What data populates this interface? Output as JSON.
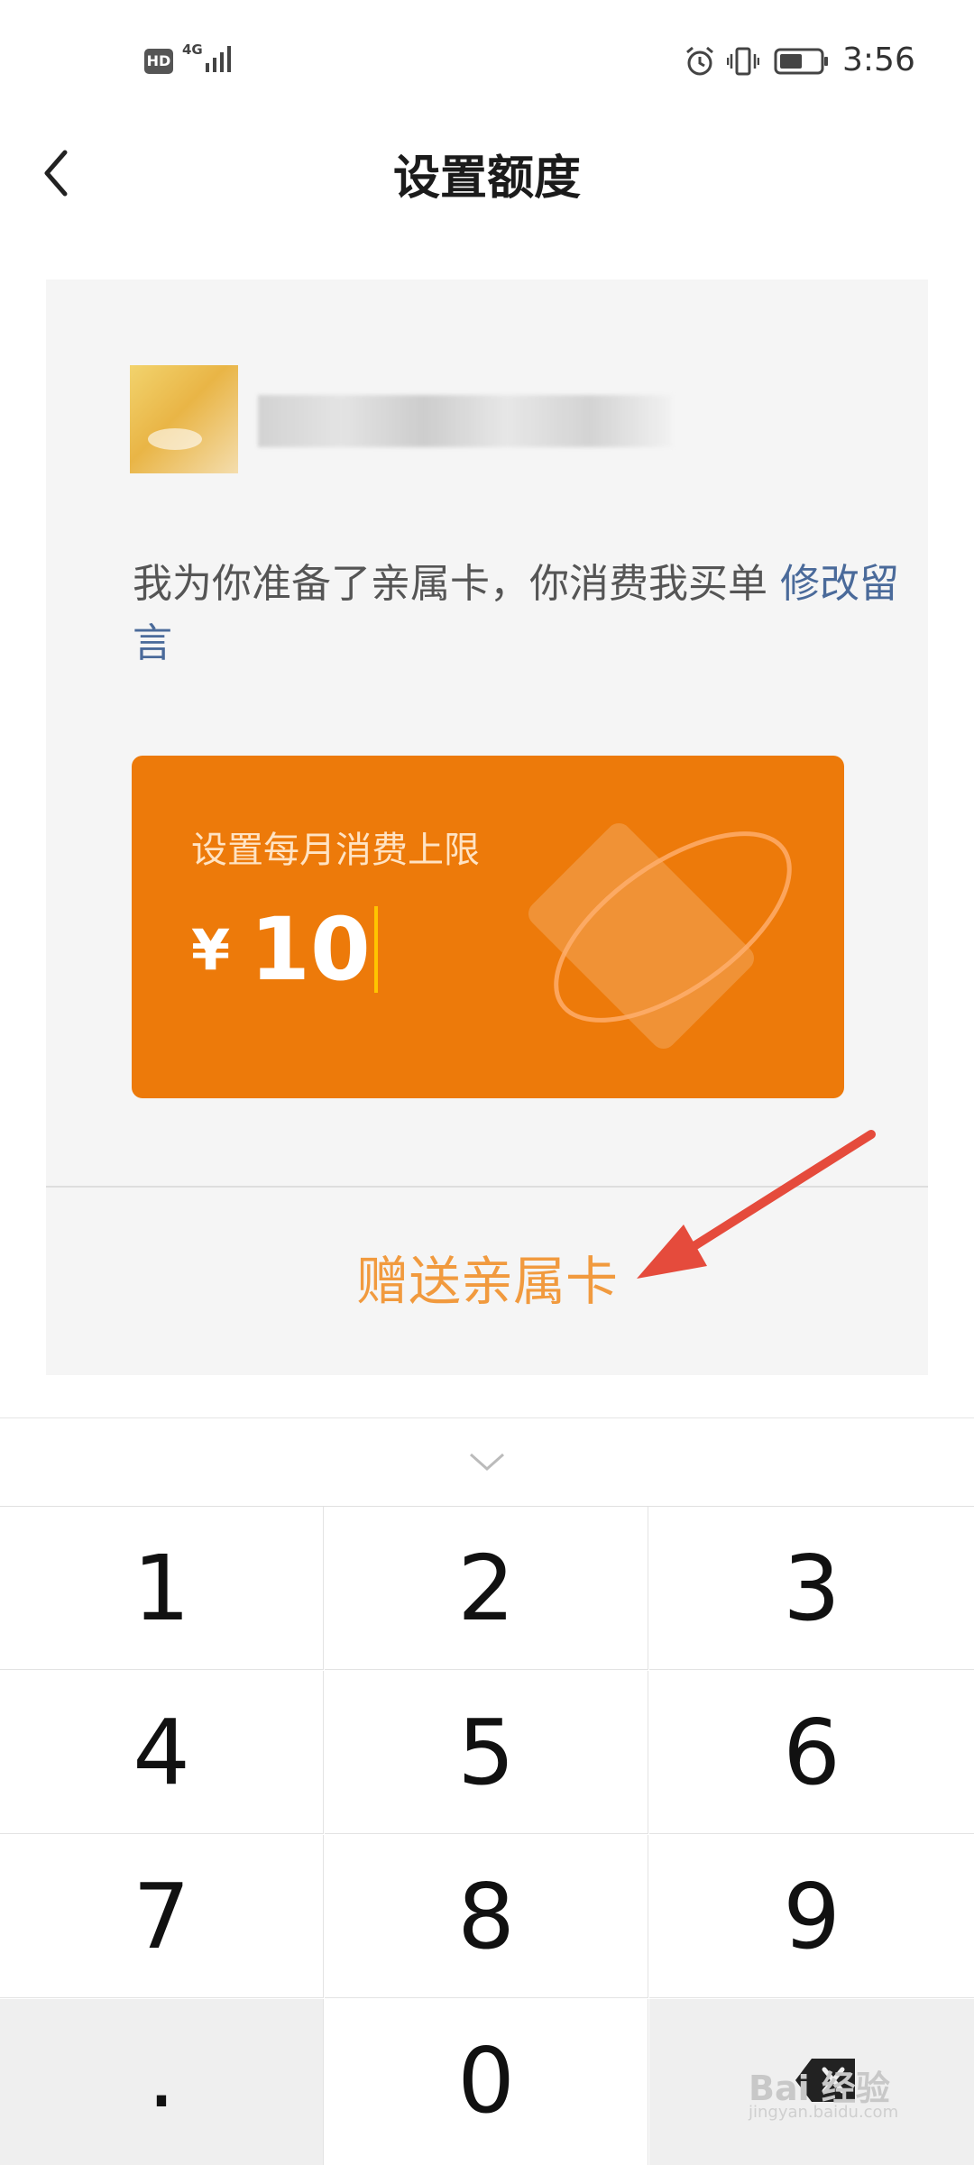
{
  "status_bar": {
    "hd_badge": "HD",
    "network": "4G",
    "time": "3:56",
    "icons": [
      "signal-icon",
      "alarm-icon",
      "vibrate-icon",
      "battery-icon"
    ]
  },
  "nav": {
    "title": "设置额度",
    "back_icon": "back-arrow-icon"
  },
  "card": {
    "message": "我为你准备了亲属卡，你消费我买单",
    "edit_link": "修改留言",
    "limit_label": "设置每月消费上限",
    "currency": "¥",
    "amount": "10",
    "send_button": "赠送亲属卡"
  },
  "keyboard": {
    "collapse_icon": "chevron-down-icon",
    "keys": [
      "1",
      "2",
      "3",
      "4",
      "5",
      "6",
      "7",
      "8",
      "9",
      ".",
      "0"
    ],
    "delete_icon": "backspace-icon"
  },
  "watermark": {
    "text": "Bai 经验",
    "sub": "jingyan.baidu.com"
  },
  "colors": {
    "card_orange": "#ed7a0a",
    "send_text": "#f19a3e",
    "link_blue": "#4a6a9a",
    "annotation_red": "#e54b3c"
  }
}
